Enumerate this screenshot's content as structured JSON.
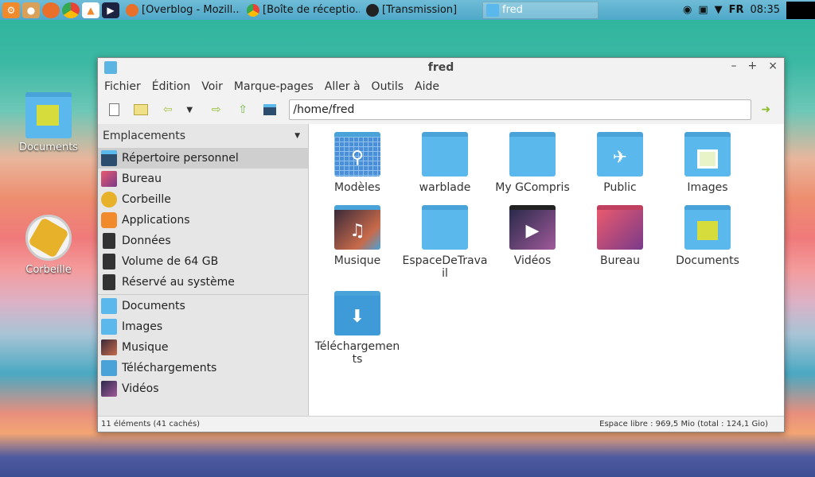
{
  "panel": {
    "tasks": [
      {
        "label": "[Overblog - Mozill..."
      },
      {
        "label": "[Boîte de réceptio..."
      },
      {
        "label": "[Transmission]"
      },
      {
        "label": "fred"
      }
    ],
    "keyboard_layout": "FR",
    "clock": "08:35"
  },
  "desktop": {
    "icons": [
      {
        "label": "Documents"
      },
      {
        "label": "Corbeille"
      }
    ]
  },
  "window": {
    "title": "fred",
    "menu": [
      "Fichier",
      "Édition",
      "Voir",
      "Marque-pages",
      "Aller à",
      "Outils",
      "Aide"
    ],
    "location": "/home/fred",
    "sidebar": {
      "header": "Emplacements",
      "places": [
        {
          "label": "Répertoire personnel"
        },
        {
          "label": "Bureau"
        },
        {
          "label": "Corbeille"
        },
        {
          "label": "Applications"
        },
        {
          "label": "Données"
        },
        {
          "label": "Volume de 64 GB"
        },
        {
          "label": "Réservé au système"
        }
      ],
      "bookmarks": [
        {
          "label": "Documents"
        },
        {
          "label": "Images"
        },
        {
          "label": "Musique"
        },
        {
          "label": "Téléchargements"
        },
        {
          "label": "Vidéos"
        }
      ]
    },
    "files": [
      {
        "label": "Modèles"
      },
      {
        "label": "warblade"
      },
      {
        "label": "My GCompris"
      },
      {
        "label": "Public"
      },
      {
        "label": "Images"
      },
      {
        "label": "Musique"
      },
      {
        "label": "EspaceDeTravail"
      },
      {
        "label": "Vidéos"
      },
      {
        "label": "Bureau"
      },
      {
        "label": "Documents"
      },
      {
        "label": "Téléchargements"
      }
    ],
    "status_left": "11 éléments (41 cachés)",
    "status_right": "Espace libre : 969,5 Mio (total : 124,1 Gio)"
  }
}
